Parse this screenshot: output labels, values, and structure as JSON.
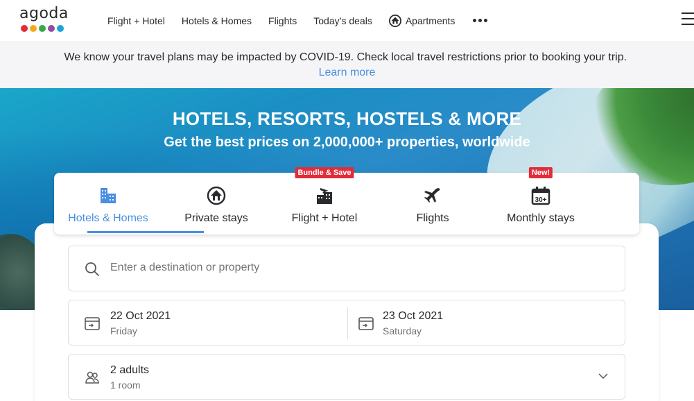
{
  "logo": {
    "text": "agoda",
    "dot_colors": [
      "#e12d39",
      "#f7a81b",
      "#38a948",
      "#8e4fa0",
      "#1aa5d8"
    ]
  },
  "nav": {
    "items": [
      {
        "label": "Flight + Hotel"
      },
      {
        "label": "Hotels & Homes"
      },
      {
        "label": "Flights"
      },
      {
        "label": "Today’s deals"
      },
      {
        "label": "Apartments",
        "icon": "apartment-icon"
      }
    ],
    "more_icon": "more-dots-icon",
    "menu_icon": "hamburger-icon"
  },
  "banner": {
    "text": "We know your travel plans may be impacted by COVID-19. Check local travel restrictions prior to booking your trip.",
    "link": "Learn more"
  },
  "hero": {
    "title": "HOTELS, RESORTS, HOSTELS & MORE",
    "subtitle": "Get the best prices on 2,000,000+ properties, worldwide"
  },
  "tabs": [
    {
      "label": "Hotels & Homes",
      "icon": "building-icon",
      "active": true
    },
    {
      "label": "Private stays",
      "icon": "house-icon"
    },
    {
      "label": "Flight + Hotel",
      "icon": "flight-hotel-icon",
      "badge": "Bundle & Save"
    },
    {
      "label": "Flights",
      "icon": "airplane-icon"
    },
    {
      "label": "Monthly stays",
      "icon": "calendar-30-icon",
      "badge": "New!"
    }
  ],
  "search": {
    "destination_placeholder": "Enter a destination or property",
    "checkin": {
      "date": "22 Oct 2021",
      "day": "Friday"
    },
    "checkout": {
      "date": "23 Oct 2021",
      "day": "Saturday"
    },
    "guests": {
      "main": "2 adults",
      "sub": "1 room"
    }
  },
  "colors": {
    "accent": "#4a8fe0",
    "badge": "#e12d39",
    "text": "#2a2a2e"
  }
}
